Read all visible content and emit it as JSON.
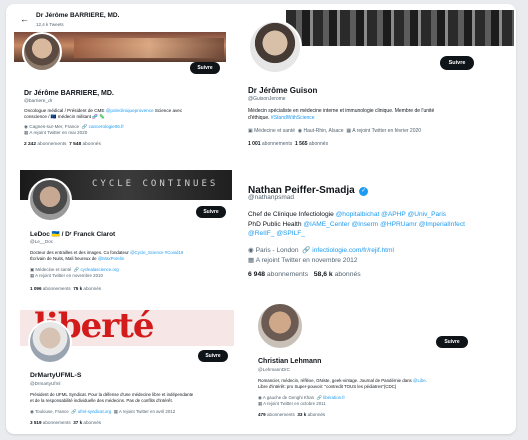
{
  "colors": {
    "accent": "#1d9bf0",
    "follow_bg": "#0f1419",
    "muted": "#536471"
  },
  "card1": {
    "top_name": "Dr Jérôme BARRIERE, MD.",
    "top_tweets": "12,4 k Tweets",
    "name": "Dr Jérôme BARRIERE, MD.",
    "handle": "@barriere_dr",
    "follow": "Suivre",
    "bio1": "Oncologue médical / Président de CME ",
    "bio1_link": "@polecliniqueprovence",
    "bio1_tail": " Science avec",
    "bio2": "conscience / 🇪🇺 médecin militant 🧬 🦠",
    "location": "Cagnes-sur-Mer, France",
    "website": "cancerologie06.fr",
    "joined": "A rejoint Twitter en mai 2020",
    "following": "2 242",
    "following_label": "abonnements",
    "followers": "7 548",
    "followers_label": "abonnés"
  },
  "card2": {
    "name": "Dr Jérôme Guison",
    "handle": "@GuisonJerome",
    "follow": "Suivre",
    "bio1": "Médecin spécialiste en médecine interne et immunologie clinique. Membre de l'unité",
    "bio2": "d'éthique. ",
    "bio2_link": "#StandWithScience",
    "category": "Médecine et santé",
    "location": "Haut-Rhin, Alsace",
    "joined": "A rejoint Twitter en février 2020",
    "following": "1 001",
    "following_label": "abonnements",
    "followers": "1 565",
    "followers_label": "abonnés"
  },
  "card3": {
    "banner_text": "CYCLE CONTINUES",
    "name": "LeDoc 🇺🇦 / Dʳ Franck Clarot",
    "handle": "@Le__Doc",
    "follow": "Suivre",
    "bio1": "Docteur des entrailles et des images. Co fondateur ",
    "bio1_link": "@Cycle_Science #Covid19",
    "bio2": "Écrivain de Nuits, Mali heureux de ",
    "bio2_link": "@MaxPorelin",
    "category": "Médecine et santé",
    "website": "cyclealascience.org",
    "joined": "A rejoint Twitter en novembre 2010",
    "following": "1 096",
    "following_label": "abonnements",
    "followers": "75 k",
    "followers_label": "abonnés"
  },
  "card4": {
    "name": "Nathan Peiffer-Smadja",
    "handle": "@nathanpsmad",
    "bio1": "Chef de Clinique Infectiologie ",
    "bio1_links": "@hopitalbichat @APHP @Univ_Paris",
    "bio2": "PhD Public Health ",
    "bio2_links": "@IAME_Center @Inserm @HPRUamr @ImperialInfect",
    "bio3_links": "@ReIIF_ @SPILF_",
    "location": "Paris - London",
    "website": "infectiologie.com/fr/rejif.html",
    "joined": "A rejoint Twitter en novembre 2012",
    "following": "6 948",
    "following_label": "abonnements",
    "followers": "58,6 k",
    "followers_label": "abonnés"
  },
  "card5": {
    "banner_text": "liberté",
    "name": "DrMartyUFML-S",
    "handle": "@DrmartyUfml",
    "follow": "Suivre",
    "bio1": "Président de UFML Syndicat. Pour la défense d'une médecine libre et indépendante",
    "bio2": "et de la responsabilité individuelle des médecins. Pas de conflits d'intérêt.",
    "location": "Toulouse, France",
    "website": "ufml-syndicat.org",
    "joined": "A rejoint Twitter en avril 2012",
    "following": "3 519",
    "following_label": "abonnements",
    "followers": "37 k",
    "followers_label": "abonnés"
  },
  "card6": {
    "name": "Christian Lehmann",
    "handle": "@LehmannDrC",
    "follow": "Suivre",
    "bio1": "Romancier, médecin, réfléxe, GNiste, geek-vintage. Journal de Pandémie dans ",
    "bio1_link": "@Libe",
    "bio1_tail": ".",
    "bio2": "Libre d'intérêt: pro Super-pouvoir: \"contredit TOUS les pédiatres\"(CDC)",
    "location": "A gauche de Genghi Khan",
    "website": "libération.fr",
    "joined": "A rejoint Twitter en octobre 2011",
    "following": "479",
    "following_label": "abonnements",
    "followers": "33 k",
    "followers_label": "abonnés"
  }
}
